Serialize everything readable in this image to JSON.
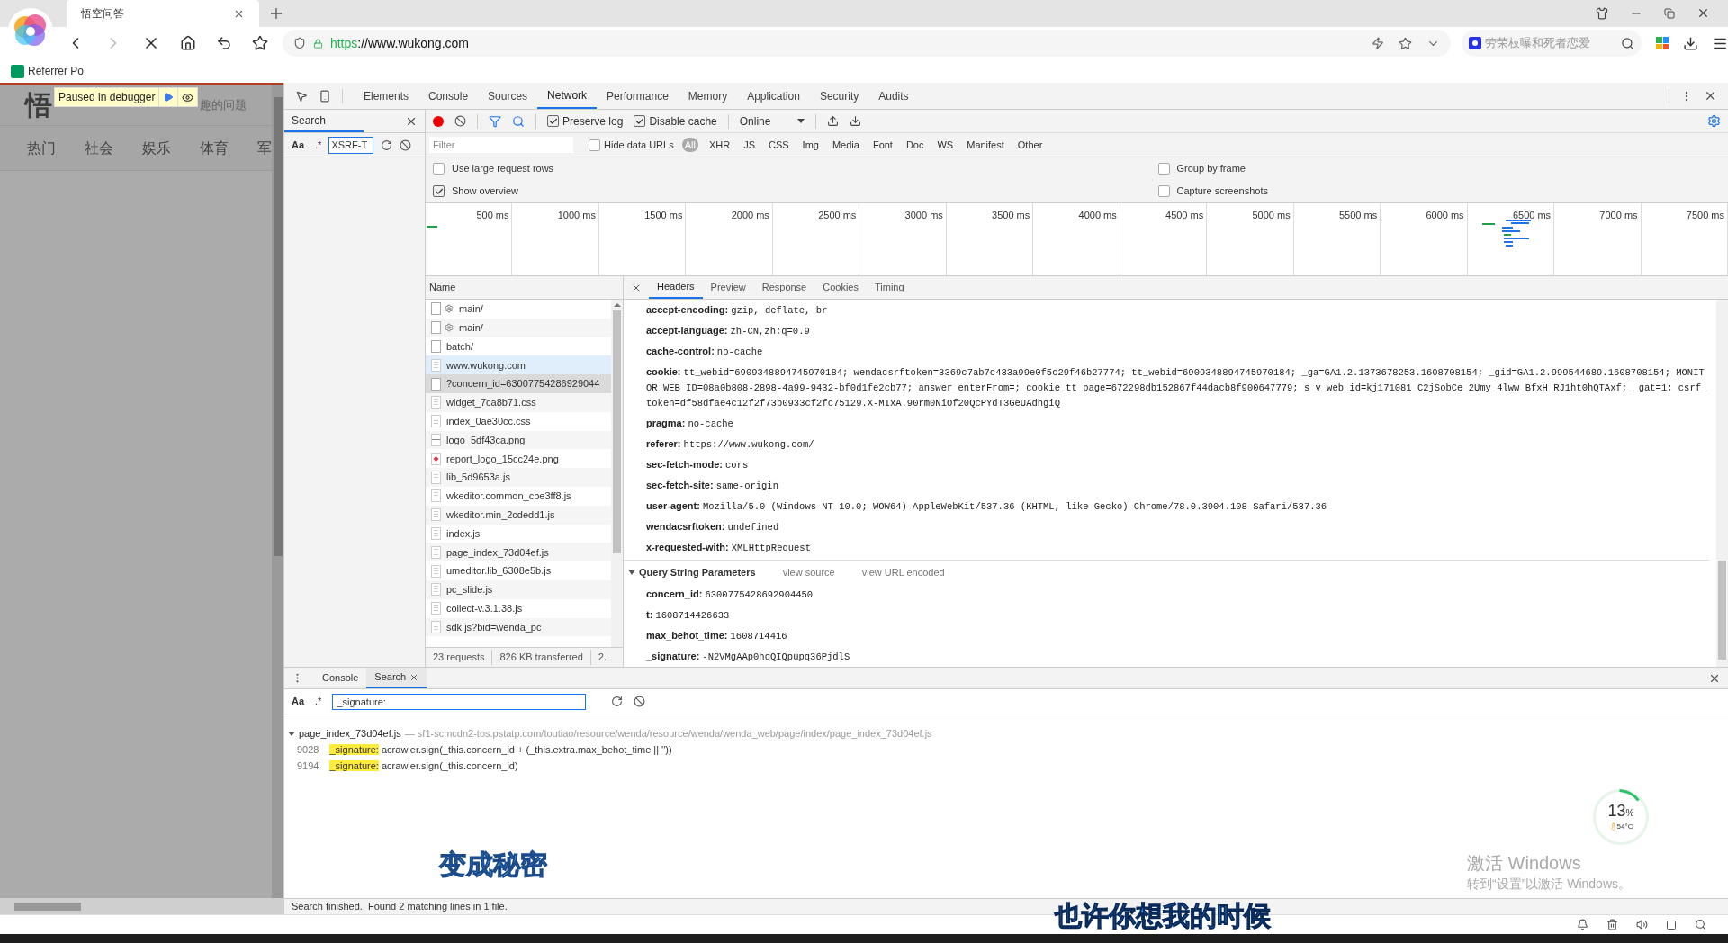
{
  "browser": {
    "tab_title": "悟空问答",
    "url_scheme": "https",
    "url_rest": "://www.wukong.com",
    "search_placeholder": "劳荣枝曝和死者恋爱",
    "bookmark": "Referrer Po"
  },
  "page": {
    "logo": "悟",
    "search_hint": "趣的问题",
    "debugger_label": "Paused in debugger",
    "nav": [
      "热门",
      "社会",
      "娱乐",
      "体育",
      "军"
    ]
  },
  "devtools": {
    "tabs": [
      {
        "label": "Elements",
        "selected": false
      },
      {
        "label": "Console",
        "selected": false
      },
      {
        "label": "Sources",
        "selected": false
      },
      {
        "label": "Network",
        "selected": true
      },
      {
        "label": "Performance",
        "selected": false
      },
      {
        "label": "Memory",
        "selected": false
      },
      {
        "label": "Application",
        "selected": false
      },
      {
        "label": "Security",
        "selected": false
      },
      {
        "label": "Audits",
        "selected": false
      }
    ],
    "search_sidebar": {
      "title": "Search",
      "case_label": "Aa",
      "regex_label": ".*",
      "query": "XSRF-T"
    },
    "toolbar": {
      "recording": true,
      "preserve_log": {
        "label": "Preserve log",
        "checked": true
      },
      "disable_cache": {
        "label": "Disable cache",
        "checked": true
      },
      "throttle": "Online"
    },
    "filter": {
      "placeholder": "Filter",
      "hide_data_urls": {
        "label": "Hide data URLs",
        "checked": false
      },
      "types": [
        {
          "label": "All",
          "selected": true
        },
        {
          "label": "XHR",
          "selected": false
        },
        {
          "label": "JS",
          "selected": false
        },
        {
          "label": "CSS",
          "selected": false
        },
        {
          "label": "Img",
          "selected": false
        },
        {
          "label": "Media",
          "selected": false
        },
        {
          "label": "Font",
          "selected": false
        },
        {
          "label": "Doc",
          "selected": false
        },
        {
          "label": "WS",
          "selected": false
        },
        {
          "label": "Manifest",
          "selected": false
        },
        {
          "label": "Other",
          "selected": false
        }
      ]
    },
    "options": [
      {
        "label": "Use large request rows",
        "checked": false
      },
      {
        "label": "Group by frame",
        "checked": false
      },
      {
        "label": "Show overview",
        "checked": true
      },
      {
        "label": "Capture screenshots",
        "checked": false
      }
    ],
    "timeline_ticks": [
      "500 ms",
      "1000 ms",
      "1500 ms",
      "2000 ms",
      "2500 ms",
      "3000 ms",
      "3500 ms",
      "4000 ms",
      "4500 ms",
      "5000 ms",
      "5500 ms",
      "6000 ms",
      "6500 ms",
      "7000 ms",
      "7500 ms"
    ],
    "name_header": "Name",
    "requests": [
      {
        "name": "main/",
        "kind": "xhr",
        "selected": false,
        "hovered": false
      },
      {
        "name": "main/",
        "kind": "xhr",
        "selected": false,
        "hovered": false
      },
      {
        "name": "batch/",
        "kind": "blank",
        "selected": false,
        "hovered": false
      },
      {
        "name": "www.wukong.com",
        "kind": "doc",
        "selected": false,
        "hovered": true
      },
      {
        "name": "?concern_id=63007754286929044",
        "kind": "blank",
        "selected": true,
        "hovered": false
      },
      {
        "name": "widget_7ca8b71.css",
        "kind": "doc",
        "selected": false,
        "hovered": false
      },
      {
        "name": "index_0ae30cc.css",
        "kind": "doc",
        "selected": false,
        "hovered": false
      },
      {
        "name": "logo_5df43ca.png",
        "kind": "image",
        "selected": false,
        "hovered": false
      },
      {
        "name": "report_logo_15cc24e.png",
        "kind": "badge",
        "selected": false,
        "hovered": false
      },
      {
        "name": "lib_5d9653a.js",
        "kind": "doc",
        "selected": false,
        "hovered": false
      },
      {
        "name": "wkeditor.common_cbe3ff8.js",
        "kind": "doc",
        "selected": false,
        "hovered": false
      },
      {
        "name": "wkeditor.min_2cdedd1.js",
        "kind": "doc",
        "selected": false,
        "hovered": false
      },
      {
        "name": "index.js",
        "kind": "doc",
        "selected": false,
        "hovered": false
      },
      {
        "name": "page_index_73d04ef.js",
        "kind": "doc",
        "selected": false,
        "hovered": false
      },
      {
        "name": "umeditor.lib_6308e5b.js",
        "kind": "doc",
        "selected": false,
        "hovered": false
      },
      {
        "name": "pc_slide.js",
        "kind": "doc",
        "selected": false,
        "hovered": false
      },
      {
        "name": "collect-v.3.1.38.js",
        "kind": "doc",
        "selected": false,
        "hovered": false
      },
      {
        "name": "sdk.js?bid=wenda_pc",
        "kind": "doc",
        "selected": false,
        "hovered": false
      }
    ],
    "summary": [
      "23 requests",
      "826 KB transferred",
      "2."
    ],
    "detail_tabs": [
      {
        "label": "Headers",
        "selected": true
      },
      {
        "label": "Preview",
        "selected": false
      },
      {
        "label": "Response",
        "selected": false
      },
      {
        "label": "Cookies",
        "selected": false
      },
      {
        "label": "Timing",
        "selected": false
      }
    ],
    "headers": [
      {
        "name": "accept-encoding:",
        "value": "gzip, deflate, br"
      },
      {
        "name": "accept-language:",
        "value": "zh-CN,zh;q=0.9"
      },
      {
        "name": "cache-control:",
        "value": "no-cache"
      },
      {
        "name": "cookie:",
        "value": "tt_webid=6909348894745970184; wendacsrftoken=3369c7ab7c433a99e0f5c29f46b27774; tt_webid=6909348894745970184; _ga=GA1.2.1373678253.1608708154; _gid=GA1.2.999544689.1608708154; MONITOR_WEB_ID=08a0b808-2898-4a99-9432-bf0d1fe2cb77; answer_enterFrom=; cookie_tt_page=672298db152867f44dacb8f900647779; s_v_web_id=kj171081_C2jSobCe_2Umy_4lww_BfxH_RJ1ht0hQTAxf; _gat=1; csrf_token=df58dfae4c12f2f73b0933cf2fc75129.X-MIxA.90rm0NiOf20QcPYdT3GeUAdhgiQ"
      },
      {
        "name": "pragma:",
        "value": "no-cache"
      },
      {
        "name": "referer:",
        "value": "https://www.wukong.com/"
      },
      {
        "name": "sec-fetch-mode:",
        "value": "cors"
      },
      {
        "name": "sec-fetch-site:",
        "value": "same-origin"
      },
      {
        "name": "user-agent:",
        "value": "Mozilla/5.0 (Windows NT 10.0; WOW64) AppleWebKit/537.36 (KHTML, like Gecko) Chrome/78.0.3904.108 Safari/537.36"
      },
      {
        "name": "wendacsrftoken:",
        "value": "undefined"
      },
      {
        "name": "x-requested-with:",
        "value": "XMLHttpRequest"
      }
    ],
    "query": {
      "title": "Query String Parameters",
      "expanded": true,
      "links": [
        "view source",
        "view URL encoded"
      ],
      "params": [
        {
          "name": "concern_id:",
          "value": "6300775428692904450"
        },
        {
          "name": "t:",
          "value": "1608714426633"
        },
        {
          "name": "max_behot_time:",
          "value": "1608714416"
        },
        {
          "name": "_signature:",
          "value": "-N2VMgAAp0hqQIQpupq36PjdlS"
        }
      ]
    }
  },
  "drawer": {
    "tabs": [
      {
        "label": "Console",
        "selected": false,
        "closable": false
      },
      {
        "label": "Search",
        "selected": true,
        "closable": true
      }
    ],
    "case_label": "Aa",
    "regex_label": ".*",
    "query": "_signature:",
    "file": {
      "name": "page_index_73d04ef.js",
      "path": "— sf1-scmcdn2-tos.pstatp.com/toutiao/resource/wenda/resource/wenda/wenda_web/page/index/page_index_73d04ef.js",
      "expanded": true
    },
    "matches": [
      {
        "line": "9028",
        "match": "_signature:",
        "rest": "acrawler.sign(_this.concern_id + (_this.extra.max_behot_time || ''))"
      },
      {
        "line": "9194",
        "match": "_signature:",
        "rest": "acrawler.sign(_this.concern_id)"
      }
    ],
    "status": "Search finished.  Found 2 matching lines in 1 file."
  },
  "overlays": {
    "subtitles": [
      "变成秘密",
      "也许你想我的时候"
    ],
    "activation": [
      "激活 Windows",
      "转到“设置”以激活 Windows。"
    ],
    "monitor": {
      "percent": "13",
      "unit": "%",
      "temp": "54°C"
    }
  }
}
